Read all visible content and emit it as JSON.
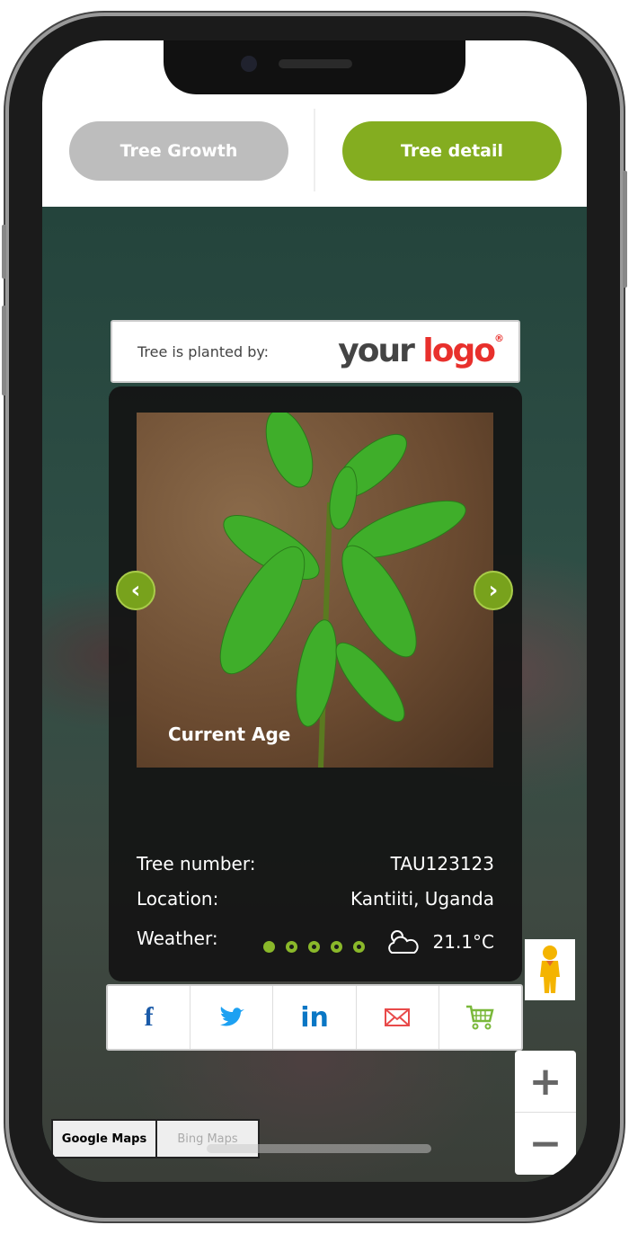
{
  "tabs": [
    {
      "label": "Tree Growth",
      "active": false
    },
    {
      "label": "Tree detail",
      "active": true
    }
  ],
  "planted": {
    "label": "Tree is planted by:",
    "logo": "your logo"
  },
  "slide": {
    "caption": "Current Age",
    "dots": 5,
    "active_dot": 1
  },
  "details": [
    {
      "label": "Tree number:",
      "value": "TAU123123"
    },
    {
      "label": "Location:",
      "value": "Kantiiti, Uganda"
    },
    {
      "label": "Weather:",
      "value": "21.1°C",
      "icon": "partly-cloudy-icon"
    }
  ],
  "share": [
    "facebook-icon",
    "twitter-icon",
    "linkedin-icon",
    "email-icon",
    "cart-icon"
  ],
  "map": {
    "types": [
      "Google Maps",
      "Bing Maps"
    ],
    "selected": "Google Maps",
    "zoom_in": "+",
    "zoom_out": "−"
  },
  "colors": {
    "accent": "#84ad20",
    "inactive": "#bdbdbd",
    "logo_red": "#e8302c"
  }
}
